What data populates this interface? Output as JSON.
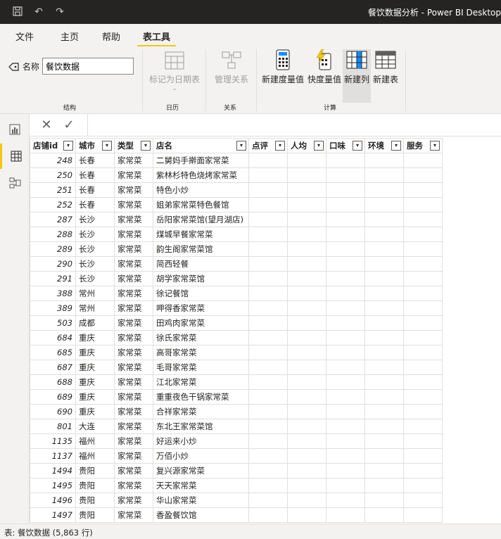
{
  "titlebar": {
    "title": "餐饮数据分析 - Power BI Desktop"
  },
  "tabs": [
    {
      "label": "文件"
    },
    {
      "label": "主页"
    },
    {
      "label": "帮助"
    },
    {
      "label": "表工具",
      "active": true
    }
  ],
  "ribbon": {
    "name_label": "名称",
    "name_value": "餐饮数据",
    "mark_date_table": "标记为日期表",
    "manage_relations": "管理关系",
    "new_measure": "新建度量值",
    "quick_measure": "快度量值",
    "new_column": "新建列",
    "new_table": "新建表",
    "groups": {
      "structure": "结构",
      "calendar": "日历",
      "relations": "关系",
      "calc": "计算"
    }
  },
  "table": {
    "columns": [
      "店铺id",
      "城市",
      "类型",
      "店名",
      "点评",
      "人均",
      "口味",
      "环境",
      "服务"
    ],
    "rows": [
      [
        "248",
        "长春",
        "家常菜",
        "二舅妈手擀面家常菜"
      ],
      [
        "250",
        "长春",
        "家常菜",
        "紫林杉特色烧烤家常菜"
      ],
      [
        "251",
        "长春",
        "家常菜",
        "特色小炒"
      ],
      [
        "252",
        "长春",
        "家常菜",
        "姐弟家常菜特色餐馆"
      ],
      [
        "287",
        "长沙",
        "家常菜",
        "岳阳家常菜馆(望月湖店)"
      ],
      [
        "288",
        "长沙",
        "家常菜",
        "煤城早餐家常菜"
      ],
      [
        "289",
        "长沙",
        "家常菜",
        "韵生阁家常菜馆"
      ],
      [
        "290",
        "长沙",
        "家常菜",
        "简西轻餐"
      ],
      [
        "291",
        "长沙",
        "家常菜",
        "胡学家常菜馆"
      ],
      [
        "388",
        "常州",
        "家常菜",
        "徐记餐馆"
      ],
      [
        "389",
        "常州",
        "家常菜",
        "呷得香家常菜"
      ],
      [
        "503",
        "成都",
        "家常菜",
        "田鸡肉家常菜"
      ],
      [
        "684",
        "重庆",
        "家常菜",
        "徐氏家常菜"
      ],
      [
        "685",
        "重庆",
        "家常菜",
        "高哥家常菜"
      ],
      [
        "687",
        "重庆",
        "家常菜",
        "毛哥家常菜"
      ],
      [
        "688",
        "重庆",
        "家常菜",
        "江北家常菜"
      ],
      [
        "689",
        "重庆",
        "家常菜",
        "重重夜色干锅家常菜"
      ],
      [
        "690",
        "重庆",
        "家常菜",
        "合祥家常菜"
      ],
      [
        "801",
        "大连",
        "家常菜",
        "东北王家常菜馆"
      ],
      [
        "1135",
        "福州",
        "家常菜",
        "好运来小炒"
      ],
      [
        "1137",
        "福州",
        "家常菜",
        "万佰小炒"
      ],
      [
        "1494",
        "贵阳",
        "家常菜",
        "复兴源家常菜"
      ],
      [
        "1495",
        "贵阳",
        "家常菜",
        "天天家常菜"
      ],
      [
        "1496",
        "贵阳",
        "家常菜",
        "华山家常菜"
      ],
      [
        "1497",
        "贵阳",
        "家常菜",
        "香盈餐饮馆"
      ]
    ]
  },
  "status": {
    "text": "表: 餐饮数据 (5,863 行)"
  },
  "colors": {
    "accent": "#f2c811",
    "titlebar": "#252423",
    "ribbon_bg": "#f3f2f1"
  }
}
